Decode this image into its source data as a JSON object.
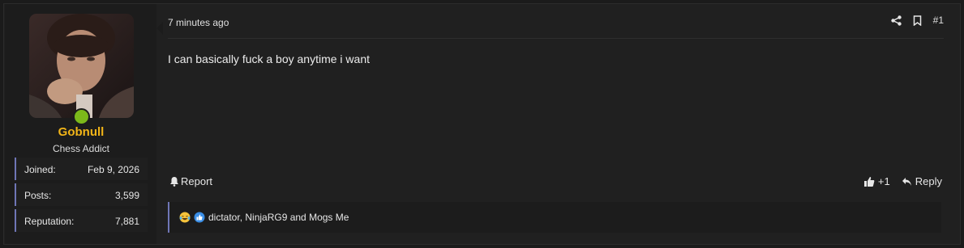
{
  "user": {
    "name": "Gobnull",
    "title": "Chess Addict",
    "online_color": "#7cb91a",
    "name_color": "#f2b518",
    "stats": [
      {
        "label": "Joined:",
        "value": "Feb 9, 2026"
      },
      {
        "label": "Posts:",
        "value": "3,599"
      },
      {
        "label": "Reputation:",
        "value": "7,881"
      }
    ]
  },
  "post": {
    "time": "7 minutes ago",
    "number": "#1",
    "content": "I can basically fuck a boy anytime i want",
    "report_label": "Report",
    "like_label": "+1",
    "reply_label": "Reply"
  },
  "reactions": {
    "text": "dictator, NinjaRG9 and Mogs Me",
    "icons": [
      "laugh-cry-emoji",
      "like-emoji"
    ]
  },
  "icons": {
    "share": "share-icon",
    "bookmark": "bookmark-icon",
    "report": "bell-icon",
    "like": "thumbs-up-icon",
    "reply": "reply-icon"
  }
}
